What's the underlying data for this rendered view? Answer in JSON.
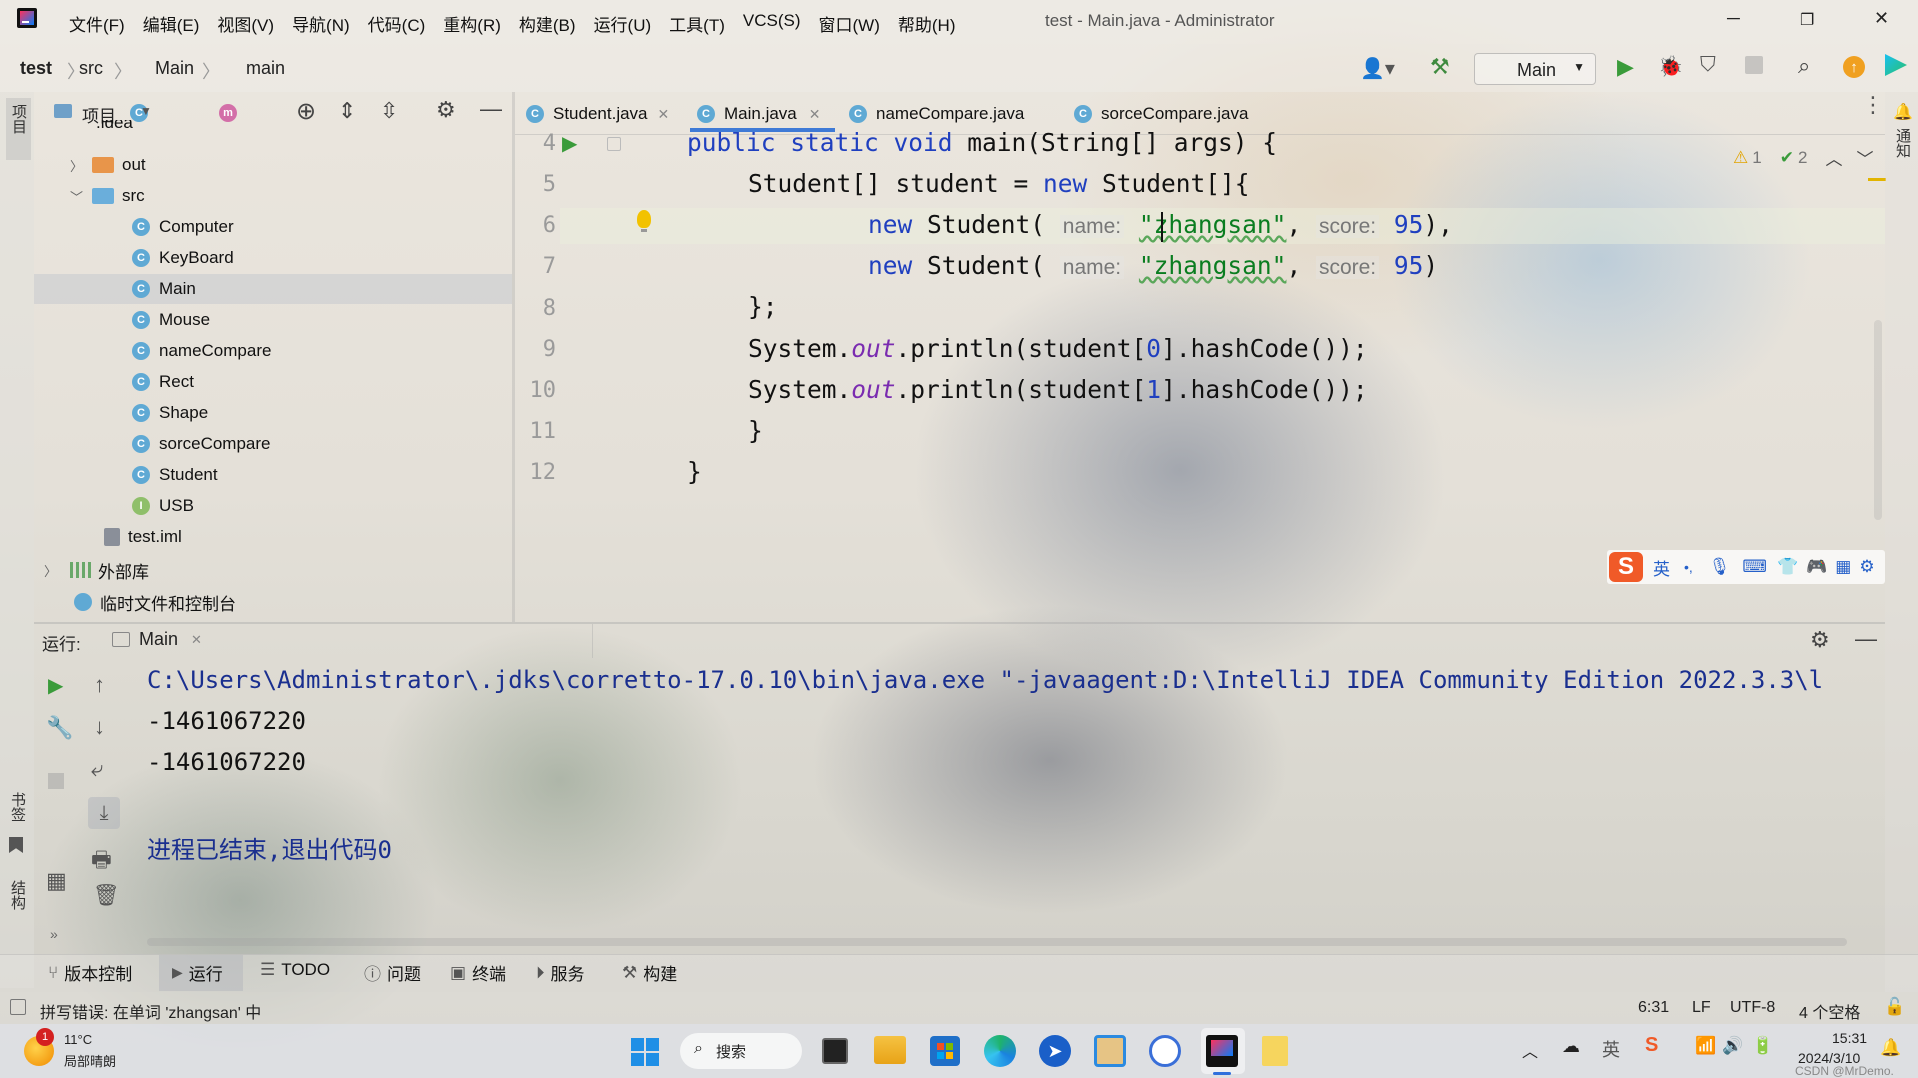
{
  "titlebar": {
    "menu": [
      "文件(F)",
      "编辑(E)",
      "视图(V)",
      "导航(N)",
      "代码(C)",
      "重构(R)",
      "构建(B)",
      "运行(U)",
      "工具(T)",
      "VCS(S)",
      "窗口(W)",
      "帮助(H)"
    ],
    "title": "test - Main.java - Administrator"
  },
  "navbar": {
    "project": "test",
    "folder": "src",
    "class": "Main",
    "method": "main",
    "run_config": "Main"
  },
  "left_stripe": {
    "project": "项目",
    "bookmarks": "书签",
    "structure": "结构"
  },
  "right_stripe": {
    "notifications": "通知"
  },
  "project_panel": {
    "header": "项目",
    "tree": [
      {
        "label": ".idea",
        "type": "folder"
      },
      {
        "label": "out",
        "type": "folder-orange"
      },
      {
        "label": "src",
        "type": "folder-blue"
      },
      {
        "label": "Computer",
        "type": "class"
      },
      {
        "label": "KeyBoard",
        "type": "class"
      },
      {
        "label": "Main",
        "type": "class"
      },
      {
        "label": "Mouse",
        "type": "class"
      },
      {
        "label": "nameCompare",
        "type": "class"
      },
      {
        "label": "Rect",
        "type": "class"
      },
      {
        "label": "Shape",
        "type": "class"
      },
      {
        "label": "sorceCompare",
        "type": "class"
      },
      {
        "label": "Student",
        "type": "class"
      },
      {
        "label": "USB",
        "type": "interface"
      },
      {
        "label": "test.iml",
        "type": "file"
      },
      {
        "label": "外部库",
        "type": "library"
      },
      {
        "label": "临时文件和控制台",
        "type": "scratch"
      }
    ],
    "class_icon_letter": "C",
    "interface_icon_letter": "I"
  },
  "editor": {
    "tabs": [
      "Student.java",
      "Main.java",
      "nameCompare.java",
      "sorceCompare.java"
    ],
    "active_tab": "Main.java",
    "inspections": {
      "warnings": "1",
      "weak_warnings": "2"
    },
    "line_numbers": [
      "4",
      "5",
      "6",
      "7",
      "8",
      "9",
      "10",
      "11",
      "12"
    ],
    "code": {
      "l4_kw": "public static void ",
      "l4_rest": "main(String[] args) {",
      "l5_a": "Student[] student = ",
      "l5_kw": "new",
      "l5_b": " Student[]{",
      "l6_kw": "new",
      "l6_a": " Student( ",
      "hint_name": "name:",
      "l6_str": "\"zhangsan\"",
      "l6_c": ", ",
      "hint_score": "score:",
      "l6_num": "95",
      "l6_end": "),",
      "l7_kw": "new",
      "l7_a": " Student( ",
      "l7_str": "\"zhangsan\"",
      "l7_c": ", ",
      "l7_num": "95",
      "l7_end": ")",
      "l8": "};",
      "l9_a": "System.",
      "l9_fld": "out",
      "l9_b": ".println(student[",
      "l9_idx": "0",
      "l9_c": "].hashCode());",
      "l10_a": "System.",
      "l10_fld": "out",
      "l10_b": ".println(student[",
      "l10_idx": "1",
      "l10_c": "].hashCode());",
      "l11": "}",
      "l12": "}"
    }
  },
  "ime_toolbar": {
    "lang": "英",
    "punct": "•,"
  },
  "run_panel": {
    "label": "运行:",
    "tab": "Main",
    "output": [
      "C:\\Users\\Administrator\\.jdks\\corretto-17.0.10\\bin\\java.exe \"-javaagent:D:\\IntelliJ IDEA Community Edition 2022.3.3\\l",
      "-1461067220",
      "-1461067220",
      "",
      "进程已结束,退出代码0"
    ]
  },
  "tool_windows": [
    "版本控制",
    "运行",
    "TODO",
    "问题",
    "终端",
    "服务",
    "构建"
  ],
  "status_bar": {
    "message": "拼写错误: 在单词 'zhangsan' 中",
    "position": "6:31",
    "line_sep": "LF",
    "encoding": "UTF-8",
    "indent": "4 个空格"
  },
  "taskbar": {
    "weather_temp": "11°C",
    "weather_desc": "局部晴朗",
    "weather_badge": "1",
    "search": "搜索",
    "time": "15:31",
    "date": "2024/3/10"
  },
  "watermark": "CSDN @MrDemo."
}
